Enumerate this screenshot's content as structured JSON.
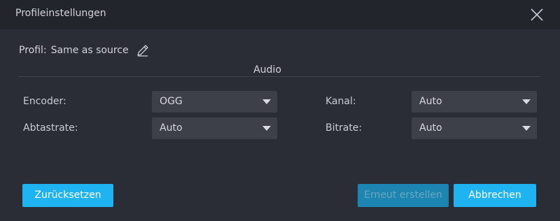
{
  "window": {
    "title": "Profileinstellungen"
  },
  "profile": {
    "label": "Profil:",
    "value": "Same as source"
  },
  "section": {
    "title": "Audio"
  },
  "fields": {
    "encoder": {
      "label": "Encoder:",
      "value": "OGG"
    },
    "kanal": {
      "label": "Kanal:",
      "value": "Auto"
    },
    "abtastrate": {
      "label": "Abtastrate:",
      "value": "Auto"
    },
    "bitrate": {
      "label": "Bitrate:",
      "value": "Auto"
    }
  },
  "buttons": {
    "reset": "Zurücksetzen",
    "recreate": "Erneut erstellen",
    "cancel": "Abbrechen"
  },
  "icons": {
    "close": "close-icon",
    "edit": "pencil-icon",
    "dropdown": "chevron-down-icon"
  },
  "colors": {
    "accent": "#1fb3f2",
    "background": "#2b2d36",
    "titlebar": "#23252d",
    "select": "#3d3f49"
  }
}
